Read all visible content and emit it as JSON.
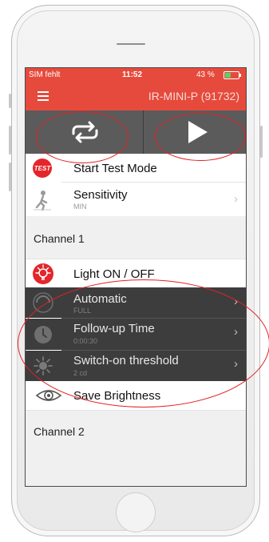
{
  "status": {
    "carrier": "SIM fehlt",
    "time": "11:52",
    "battery": "43 %"
  },
  "nav": {
    "title": "IR-MINI-P  (91732)"
  },
  "items": {
    "test": {
      "badge": "TEST",
      "label": "Start Test Mode"
    },
    "sensitivity": {
      "label": "Sensitivity",
      "value": "MIN"
    },
    "channel1": "Channel 1",
    "light": {
      "label": "Light ON / OFF"
    },
    "automatic": {
      "label": "Automatic",
      "value": "FULL"
    },
    "followup": {
      "label": "Follow-up Time",
      "value": "0:00:30"
    },
    "threshold": {
      "label": "Switch-on threshold",
      "value": "2 cd"
    },
    "brightness": {
      "label": "Save Brightness"
    },
    "channel2": "Channel 2"
  },
  "colors": {
    "accent": "#e64a3c",
    "dark_row": "#3d3d3d",
    "toolbar": "#5b5b5b",
    "highlight_ring": "#e02222"
  },
  "icons": {
    "menu": "hamburger-icon",
    "repeat": "repeat-icon",
    "play": "play-icon",
    "test": "test-badge-icon",
    "sensitivity": "walking-person-icon",
    "light": "bulb-icon",
    "automatic": "auto-icon",
    "followup": "clock-icon",
    "threshold": "sun-icon",
    "brightness": "eye-icon"
  }
}
